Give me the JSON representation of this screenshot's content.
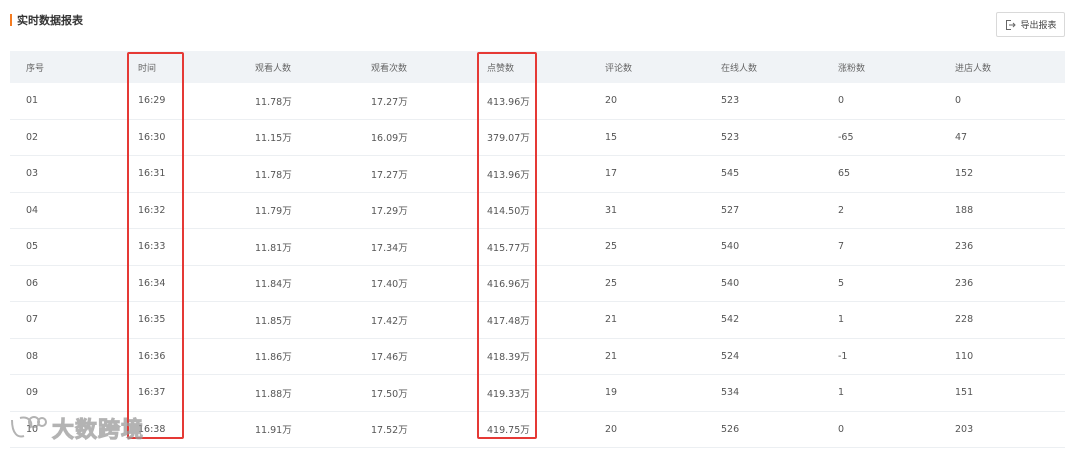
{
  "report": {
    "title": "实时数据报表",
    "export_label": "导出报表"
  },
  "table": {
    "headers": [
      "序号",
      "时间",
      "观看人数",
      "观看次数",
      "点赞数",
      "评论数",
      "在线人数",
      "涨粉数",
      "进店人数"
    ],
    "rows": [
      [
        "01",
        "16:29",
        "11.78万",
        "17.27万",
        "413.96万",
        "20",
        "523",
        "0",
        "0"
      ],
      [
        "02",
        "16:30",
        "11.15万",
        "16.09万",
        "379.07万",
        "15",
        "523",
        "-65",
        "47"
      ],
      [
        "03",
        "16:31",
        "11.78万",
        "17.27万",
        "413.96万",
        "17",
        "545",
        "65",
        "152"
      ],
      [
        "04",
        "16:32",
        "11.79万",
        "17.29万",
        "414.50万",
        "31",
        "527",
        "2",
        "188"
      ],
      [
        "05",
        "16:33",
        "11.81万",
        "17.34万",
        "415.77万",
        "25",
        "540",
        "7",
        "236"
      ],
      [
        "06",
        "16:34",
        "11.84万",
        "17.40万",
        "416.96万",
        "25",
        "540",
        "5",
        "236"
      ],
      [
        "07",
        "16:35",
        "11.85万",
        "17.42万",
        "417.48万",
        "21",
        "542",
        "1",
        "228"
      ],
      [
        "08",
        "16:36",
        "11.86万",
        "17.46万",
        "418.39万",
        "21",
        "524",
        "-1",
        "110"
      ],
      [
        "09",
        "16:37",
        "11.88万",
        "17.50万",
        "419.33万",
        "19",
        "534",
        "1",
        "151"
      ],
      [
        "10",
        "16:38",
        "11.91万",
        "17.52万",
        "419.75万",
        "20",
        "526",
        "0",
        "203"
      ]
    ]
  },
  "watermark": {
    "text": "大数跨境",
    "icon": "brand-logo-icon"
  },
  "colors": {
    "accent": "#f57c21",
    "highlight": "#e53935",
    "header_bg": "#f0f3f6"
  }
}
